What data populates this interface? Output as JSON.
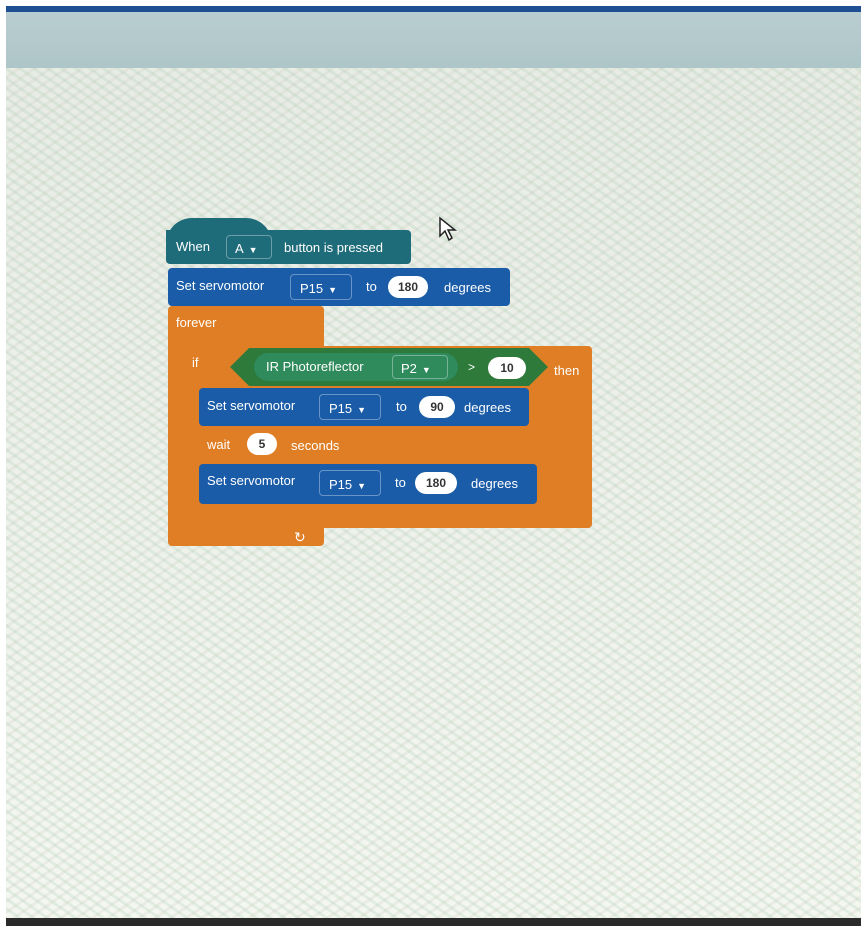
{
  "workspace": {
    "cursor": "arrow-cursor-icon"
  },
  "event_block": {
    "prefix": "When",
    "button_option": "A",
    "suffix": "button is pressed"
  },
  "servo_1": {
    "label": "Set servomotor",
    "pin": "P15",
    "to": "to",
    "angle": "180",
    "unit": "degrees"
  },
  "forever_block": {
    "label": "forever",
    "loop_icon": "loop-arrow-icon"
  },
  "if_block": {
    "if_label": "if",
    "sensor_label": "IR Photoreflector",
    "sensor_pin": "P2",
    "operator": ">",
    "threshold": "10",
    "then_label": "then"
  },
  "servo_2": {
    "label": "Set servomotor",
    "pin": "P15",
    "to": "to",
    "angle": "90",
    "unit": "degrees"
  },
  "wait_block": {
    "label": "wait",
    "value": "5",
    "unit": "seconds"
  },
  "servo_3": {
    "label": "Set servomotor",
    "pin": "P15",
    "to": "to",
    "angle": "180",
    "unit": "degrees"
  },
  "colors": {
    "event_block": "#1e6b79",
    "servo_block": "#1a5ca8",
    "control_block": "#e07e25",
    "condition_block": "#2e7a3a",
    "sensor_block": "#2f8a5c"
  }
}
